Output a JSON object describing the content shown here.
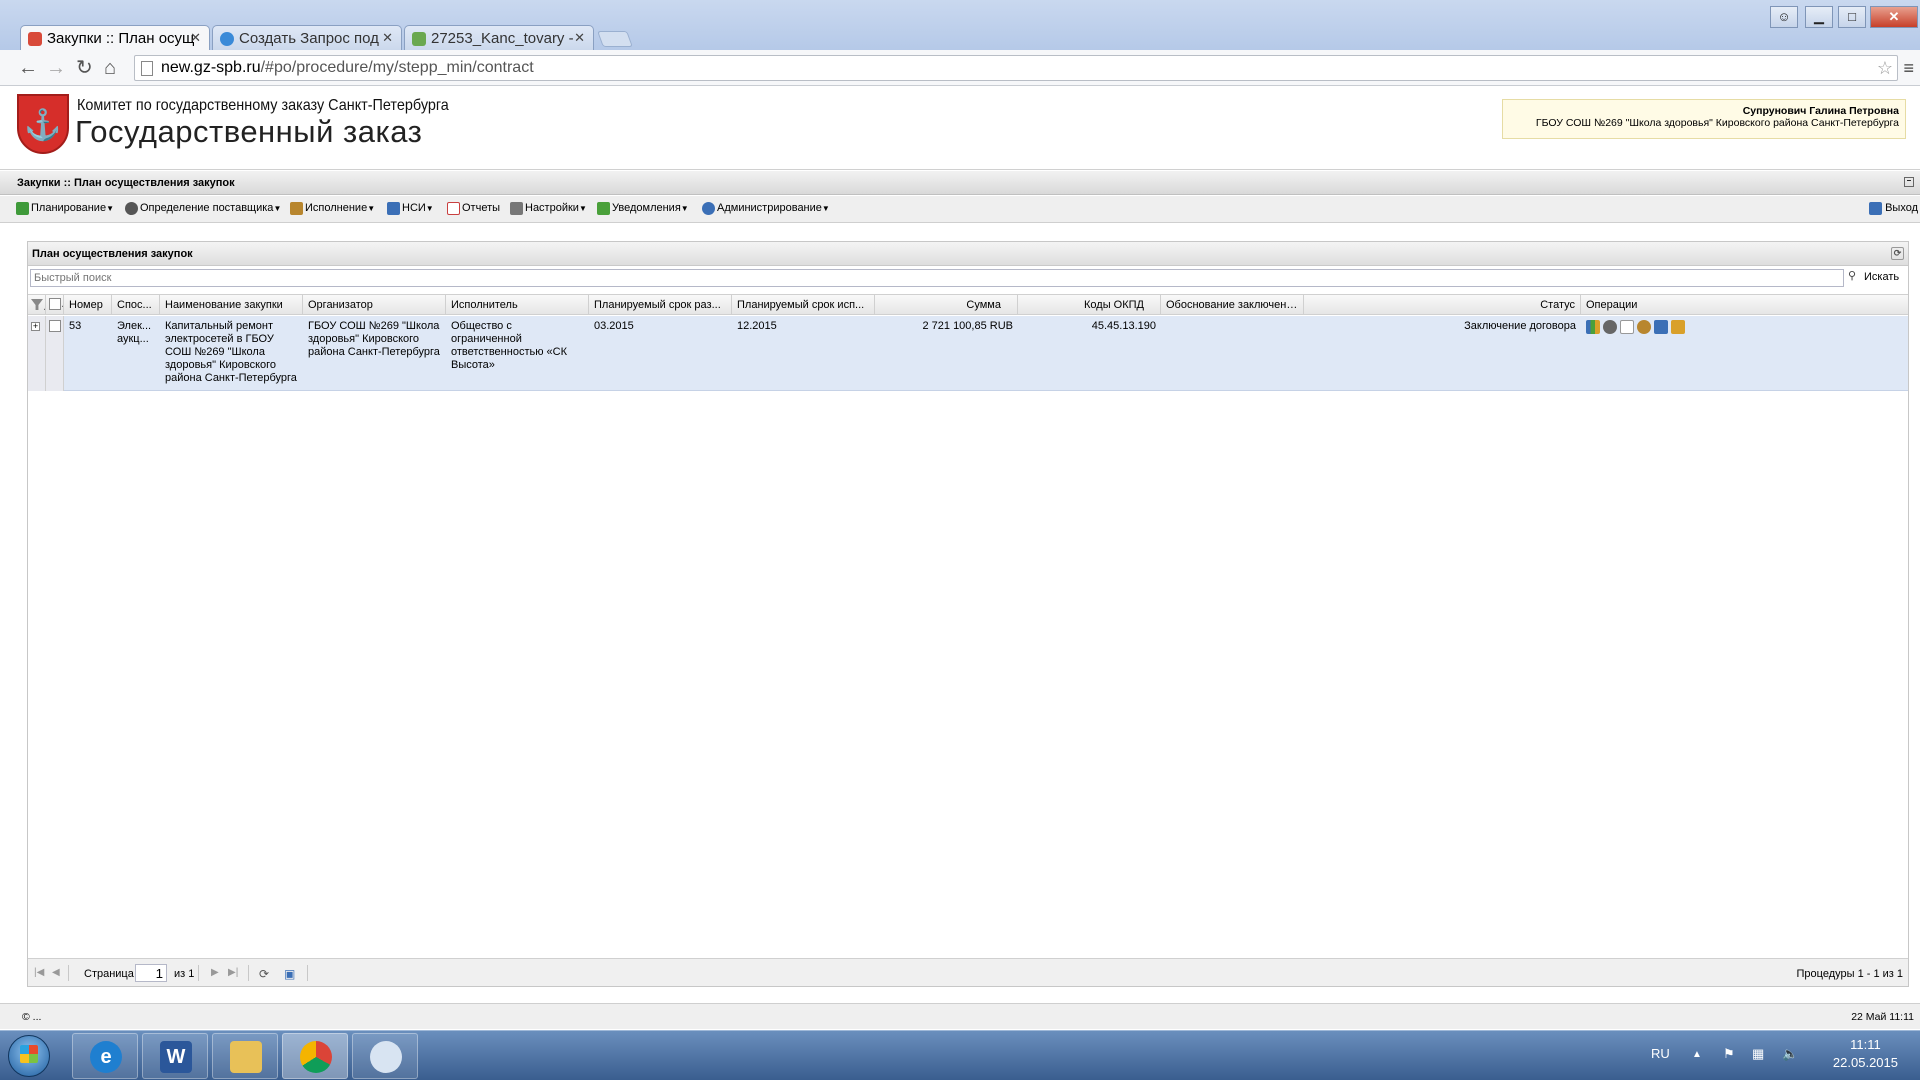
{
  "browser": {
    "tabs": [
      {
        "title": "Закупки :: План осущ",
        "active": true
      },
      {
        "title": "Создать Запрос под",
        "active": false
      },
      {
        "title": "27253_Kanc_tovary -",
        "active": false
      }
    ],
    "url_host": "new.gz-spb.ru",
    "url_path": "/#po/procedure/my/stepp_min/contract"
  },
  "header": {
    "org": "Комитет по государственному заказу Санкт-Петербурга",
    "title": "Государственный заказ",
    "user_name": "Супрунович Галина Петровна",
    "user_org": "ГБОУ СОШ №269 \"Школа здоровья\" Кировского района Санкт-Петербурга"
  },
  "section": {
    "title": "Закупки :: План осуществления закупок"
  },
  "menu": [
    {
      "label": "Планирование",
      "color": "#3f9a3a"
    },
    {
      "label": "Определение поставщика",
      "color": "#555555"
    },
    {
      "label": "Исполнение",
      "color": "#b8862e"
    },
    {
      "label": "НСИ",
      "color": "#3b6fb6"
    },
    {
      "label": "Отчеты",
      "color": "#c94040"
    },
    {
      "label": "Настройки",
      "color": "#777777"
    },
    {
      "label": "Уведомления",
      "color": "#4aa03a"
    },
    {
      "label": "Администрирование",
      "color": "#3b6fb6"
    }
  ],
  "logout": "Выход",
  "panel": {
    "title": "План осуществления закупок",
    "search_placeholder": "Быстрый поиск",
    "search_button": "Искать"
  },
  "columns": [
    "Номер",
    "Спос...",
    "Наименование закупки",
    "Организатор",
    "Исполнитель",
    "Планируемый срок раз...",
    "Планируемый срок исп...",
    "Сумма",
    "Коды ОКПД",
    "Обоснование заключения",
    "Статус",
    "Операции"
  ],
  "rows": [
    {
      "number": "53",
      "method": "Элек... аукц...",
      "name": "Капитальный ремонт электросетей в ГБОУ СОШ №269 \"Школа здоровья\" Кировского района Санкт-Петербурга",
      "organizer": "ГБОУ СОШ №269 \"Школа здоровья\" Кировского района Санкт-Петербурга",
      "executor": "Общество с ограниченной ответственностью «СК Высота»",
      "plan_place": "03.2015",
      "plan_exec": "12.2015",
      "sum": "2 721 100,85 RUB",
      "okpd": "45.45.13.190",
      "basis": "",
      "status": "Заключение договора"
    }
  ],
  "pager": {
    "page_label": "Страница",
    "page": "1",
    "of_label": "из 1",
    "info": "Процедуры 1 - 1 из 1"
  },
  "status": {
    "left": "© ...",
    "right": "22 Май 11:11"
  },
  "taskbar": {
    "lang": "RU",
    "time": "11:11",
    "date": "22.05.2015"
  }
}
